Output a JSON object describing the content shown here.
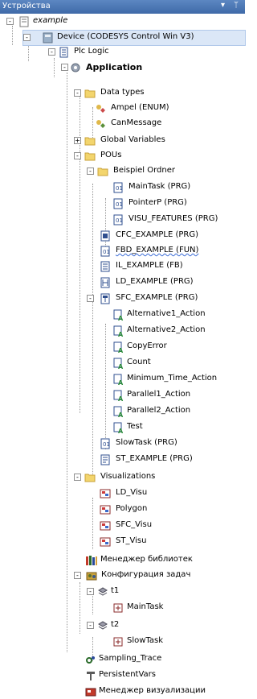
{
  "panel": {
    "title": "Устройства",
    "dropdown_icon": "▾",
    "pin_icon": "ᛘ"
  },
  "tree": [
    {
      "label": "example",
      "icon": "project",
      "expand": "-"
    },
    {
      "label": "Device (CODESYS Control Win V3)",
      "icon": "device",
      "expand": "-"
    },
    {
      "label": "Plc Logic",
      "icon": "plc",
      "expand": "-"
    },
    {
      "label": "Application",
      "icon": "gear",
      "expand": "-"
    },
    {
      "label": "Data types",
      "icon": "folder",
      "expand": "-"
    },
    {
      "label": "Ampel (ENUM)",
      "icon": "dut"
    },
    {
      "label": "CanMessage",
      "icon": "dut"
    },
    {
      "label": "Global Variables",
      "icon": "folder",
      "expand": "+"
    },
    {
      "label": "POUs",
      "icon": "folder",
      "expand": "-"
    },
    {
      "label": "Beispiel Ordner",
      "icon": "folder",
      "expand": "-"
    },
    {
      "label": "MainTask (PRG)",
      "icon": "pou-st"
    },
    {
      "label": "PointerP (PRG)",
      "icon": "pou-st"
    },
    {
      "label": "VISU_FEATURES (PRG)",
      "icon": "pou-st"
    },
    {
      "label": "CFC_EXAMPLE (PRG)",
      "icon": "pou-cfc"
    },
    {
      "label": "FBD_EXAMPLE (FUN)",
      "icon": "pou-fbd"
    },
    {
      "label": "IL_EXAMPLE (FB)",
      "icon": "pou-il"
    },
    {
      "label": "LD_EXAMPLE (PRG)",
      "icon": "pou-ld"
    },
    {
      "label": "SFC_EXAMPLE (PRG)",
      "icon": "pou-sfc",
      "expand": "-"
    },
    {
      "label": "Alternative1_Action",
      "icon": "action"
    },
    {
      "label": "Alternative2_Action",
      "icon": "action"
    },
    {
      "label": "CopyError",
      "icon": "action-st"
    },
    {
      "label": "Count",
      "icon": "action"
    },
    {
      "label": "Minimum_Time_Action",
      "icon": "action-il"
    },
    {
      "label": "Parallel1_Action",
      "icon": "action"
    },
    {
      "label": "Parallel2_Action",
      "icon": "action"
    },
    {
      "label": "Test",
      "icon": "action-st"
    },
    {
      "label": "SlowTask (PRG)",
      "icon": "pou-st"
    },
    {
      "label": "ST_EXAMPLE (PRG)",
      "icon": "pou-doc"
    },
    {
      "label": "Visualizations",
      "icon": "folder",
      "expand": "-"
    },
    {
      "label": "LD_Visu",
      "icon": "visu"
    },
    {
      "label": "Polygon",
      "icon": "visu"
    },
    {
      "label": "SFC_Visu",
      "icon": "visu"
    },
    {
      "label": "ST_Visu",
      "icon": "visu"
    },
    {
      "label": "Менеджер библиотек",
      "icon": "library"
    },
    {
      "label": "Конфигурация задач",
      "icon": "taskconfig",
      "expand": "-"
    },
    {
      "label": "t1",
      "icon": "task",
      "expand": "-"
    },
    {
      "label": "MainTask",
      "icon": "taskcall"
    },
    {
      "label": "t2",
      "icon": "task",
      "expand": "-"
    },
    {
      "label": "SlowTask",
      "icon": "taskcall"
    },
    {
      "label": "Sampling_Trace",
      "icon": "trace"
    },
    {
      "label": "PersistentVars",
      "icon": "persistent"
    },
    {
      "label": "Менеджер визуализации",
      "icon": "visumanager"
    }
  ]
}
